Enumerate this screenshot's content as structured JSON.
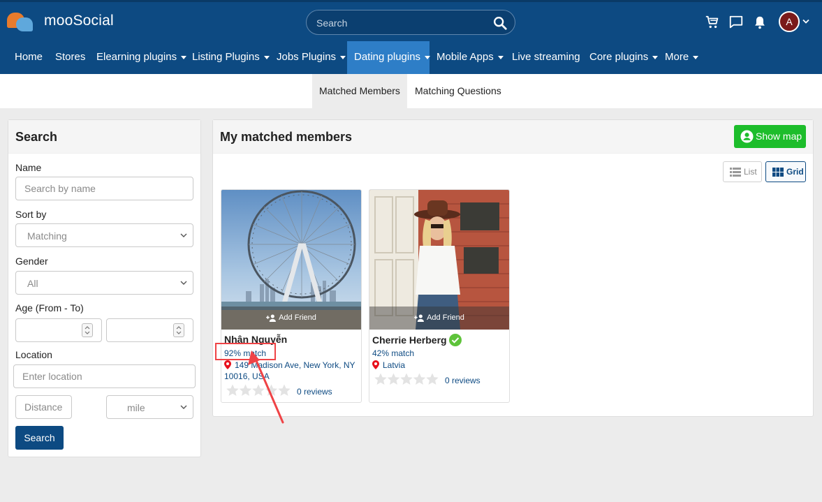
{
  "header": {
    "brand": "mooSocial",
    "search_placeholder": "Search",
    "avatar_initial": "A"
  },
  "nav": {
    "items": [
      {
        "label": "Home",
        "has_menu": false
      },
      {
        "label": "Stores",
        "has_menu": false
      },
      {
        "label": "Elearning plugins",
        "has_menu": true
      },
      {
        "label": "Listing Plugins",
        "has_menu": true
      },
      {
        "label": "Jobs Plugins",
        "has_menu": true
      },
      {
        "label": "Dating plugins",
        "has_menu": true,
        "active": true
      },
      {
        "label": "Mobile Apps",
        "has_menu": true
      },
      {
        "label": "Live streaming",
        "has_menu": false
      },
      {
        "label": "Core plugins",
        "has_menu": true
      },
      {
        "label": "More",
        "has_menu": true
      }
    ]
  },
  "subtabs": {
    "matched": "Matched Members",
    "questions": "Matching Questions",
    "active": "Matched Members"
  },
  "search_panel": {
    "title": "Search",
    "name_label": "Name",
    "name_placeholder": "Search by name",
    "sort_label": "Sort by",
    "sort_value": "Matching",
    "gender_label": "Gender",
    "gender_value": "All",
    "age_label": "Age (From - To)",
    "location_label": "Location",
    "location_placeholder": "Enter location",
    "distance_placeholder": "Distance",
    "unit_value": "mile",
    "search_button": "Search"
  },
  "main": {
    "title": "My matched members",
    "show_map": "Show map",
    "view_list": "List",
    "view_grid": "Grid",
    "view_active": "Grid",
    "add_friend": "Add Friend",
    "members": [
      {
        "name": "Nhân Nguyễn",
        "match": "92% match",
        "location": "149 Madison Ave, New York, NY 10016, USA",
        "reviews": "0 reviews",
        "verified": false
      },
      {
        "name": "Cherrie Herberg",
        "match": "42% match",
        "location": "Latvia",
        "reviews": "0 reviews",
        "verified": true
      }
    ]
  },
  "colors": {
    "header_bg": "#0d4a82",
    "nav_active": "#2e7ec7",
    "show_map_green": "#1dbd2b",
    "highlight_red": "#ef4346",
    "link_blue": "#0d4a82"
  }
}
